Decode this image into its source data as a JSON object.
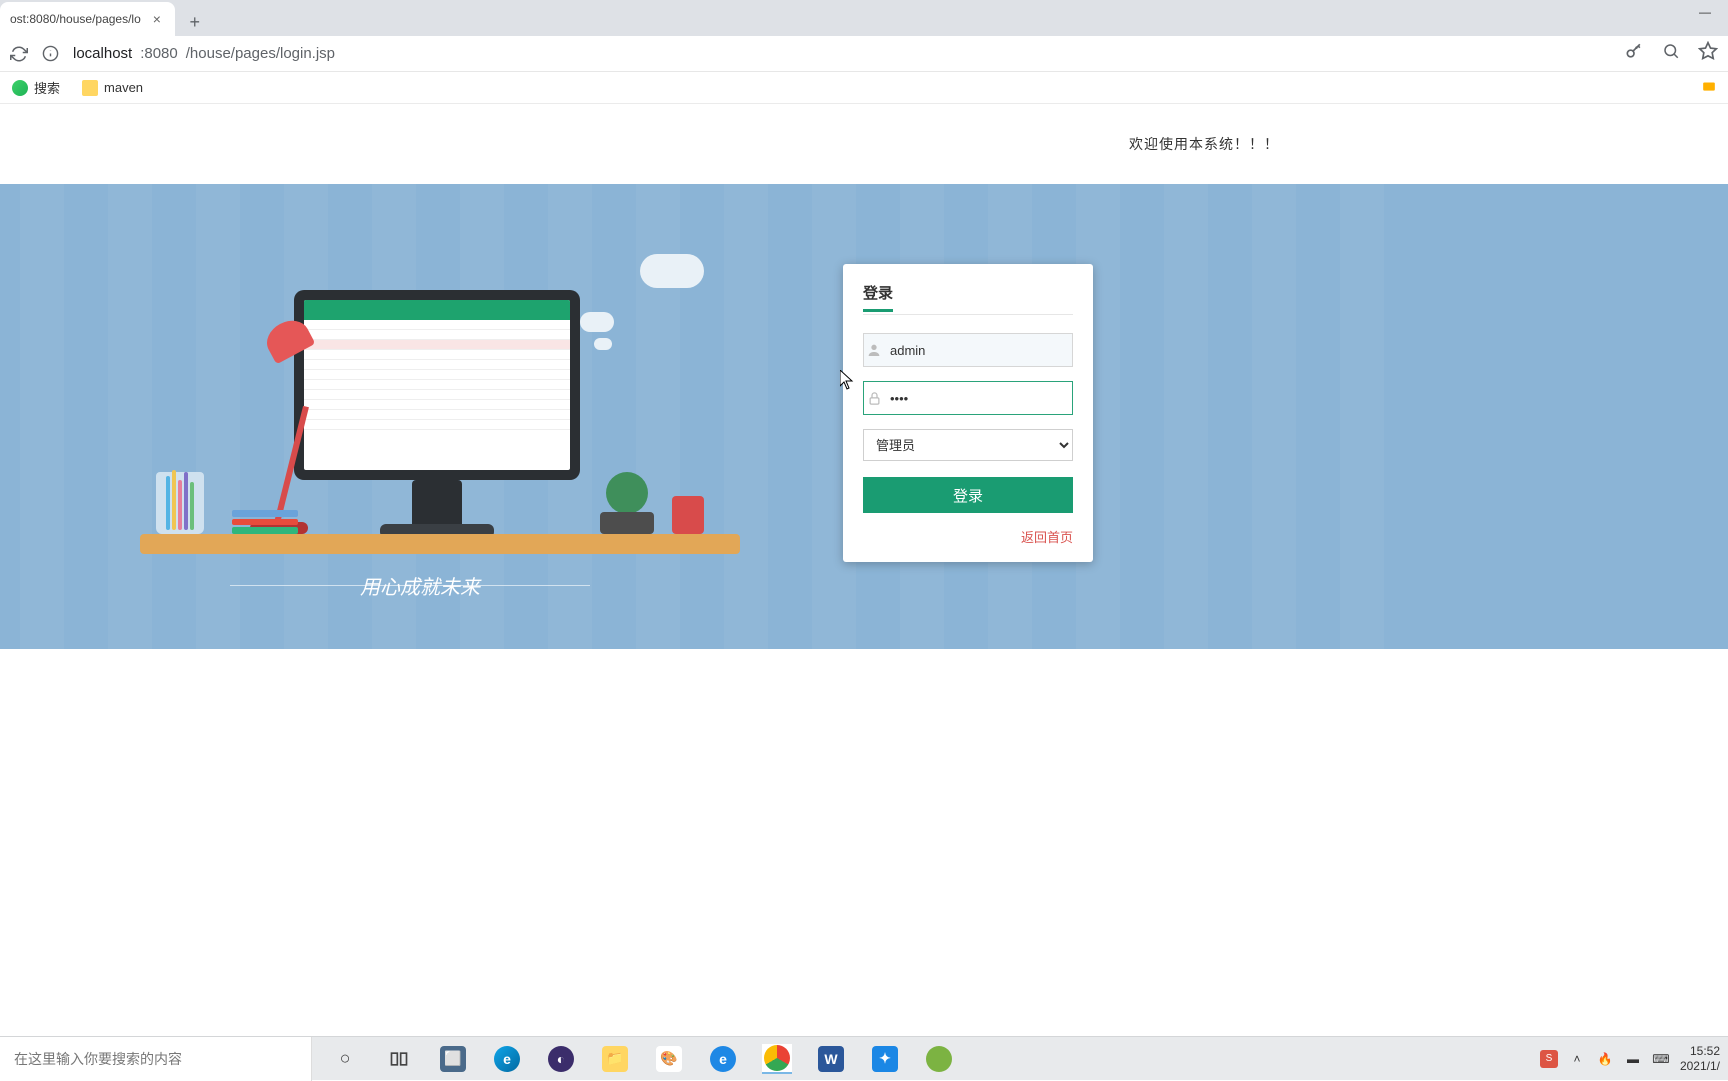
{
  "browser": {
    "tab_title": "ost:8080/house/pages/lo",
    "url_host": "localhost",
    "url_port": ":8080",
    "url_path": "/house/pages/login.jsp",
    "bookmarks": {
      "search": "搜索",
      "maven": "maven"
    }
  },
  "page": {
    "welcome": "欢迎使用本系统！！！",
    "slogan": "用心成就未来"
  },
  "login": {
    "title": "登录",
    "username_value": "admin",
    "password_value": "••••",
    "role_selected": "管理员",
    "submit_label": "登录",
    "back_label": "返回首页"
  },
  "taskbar": {
    "search_placeholder": "在这里输入你要搜索的内容",
    "time": "15:52",
    "date": "2021/1/"
  },
  "colors": {
    "accent": "#1a9c72",
    "hero_bg": "#8bb4d6",
    "danger": "#d9534f"
  }
}
